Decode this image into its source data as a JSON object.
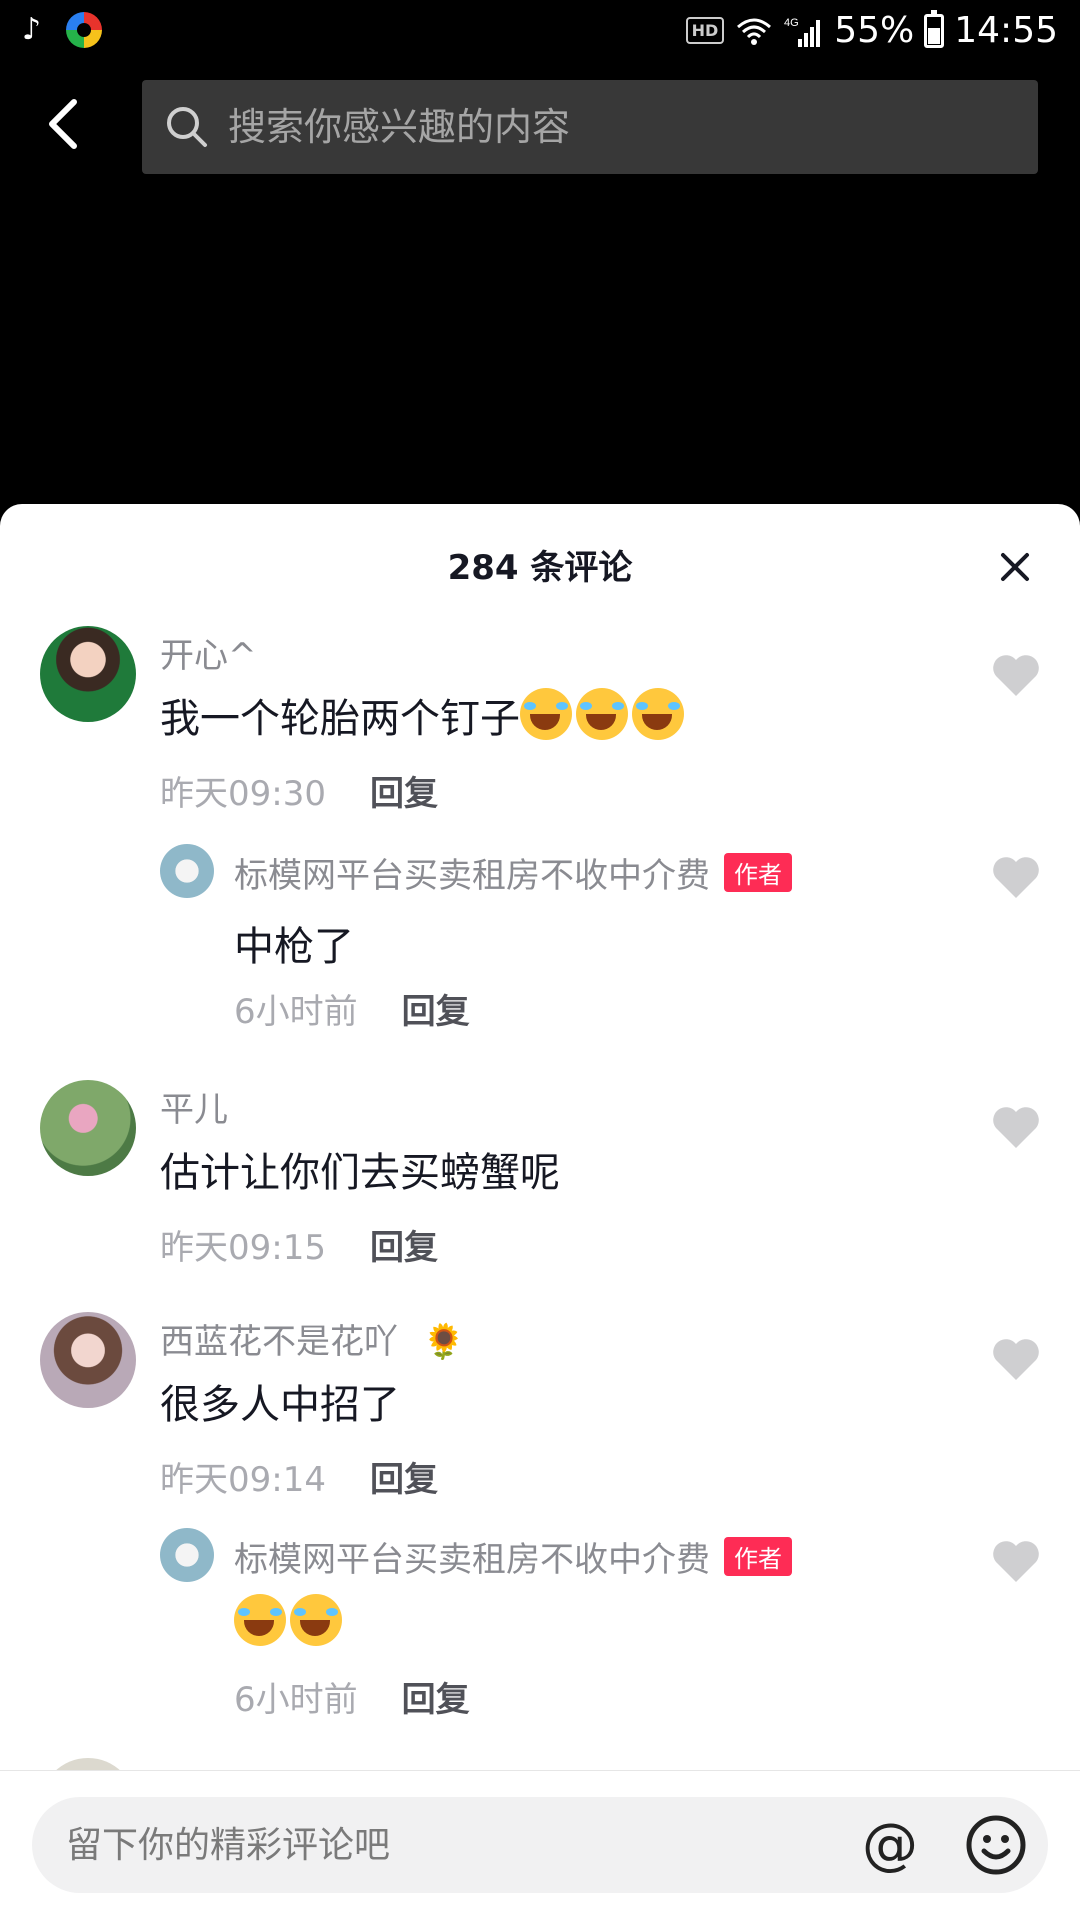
{
  "status_bar": {
    "hd": "HD",
    "network": "4G",
    "battery": "55%",
    "time": "14:55"
  },
  "search": {
    "placeholder": "搜索你感兴趣的内容"
  },
  "sheet": {
    "title": "284 条评论"
  },
  "comments": [
    {
      "username": "开心^",
      "text": "我一个轮胎两个钉子",
      "emoji_count": 3,
      "time": "昨天09:30",
      "reply": "回复",
      "replies": [
        {
          "username": "标模网平台买卖租房不收中介费",
          "badge": "作者",
          "text": "中枪了",
          "time": "6小时前",
          "reply": "回复"
        }
      ]
    },
    {
      "username": "平儿",
      "text": "估计让你们去买螃蟹呢",
      "time": "昨天09:15",
      "reply": "回复"
    },
    {
      "username": "西蓝花不是花吖",
      "username_emoji": "🌻",
      "text": "很多人中招了",
      "time": "昨天09:14",
      "reply": "回复",
      "replies": [
        {
          "username": "标模网平台买卖租房不收中介费",
          "badge": "作者",
          "emoji_count": 2,
          "time": "6小时前",
          "reply": "回复"
        }
      ]
    }
  ],
  "input_bar": {
    "placeholder": "留下你的精彩评论吧",
    "mention_symbol": "@"
  },
  "colors": {
    "accent": "#fe2c55",
    "text_primary": "#161823",
    "text_secondary": "#8a8b91",
    "like_gray": "#cfcfd1"
  }
}
